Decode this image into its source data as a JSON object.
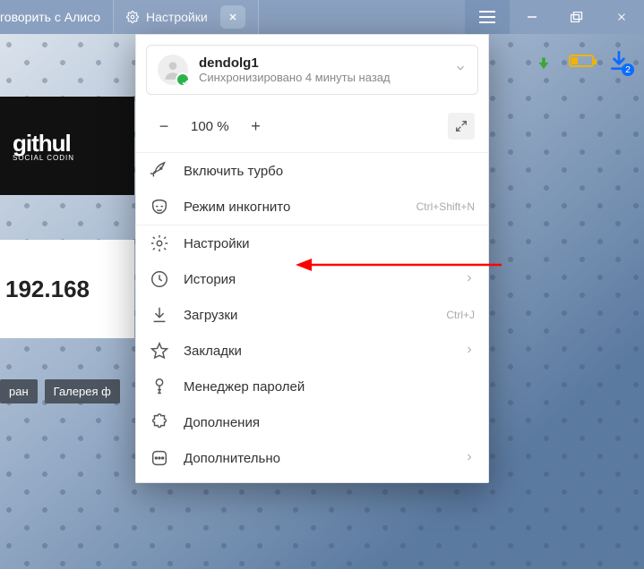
{
  "titlebar": {
    "tabs": [
      {
        "label": "говорить с Алисо"
      },
      {
        "label": "Настройки"
      }
    ]
  },
  "tray": {
    "download_count": "2"
  },
  "page": {
    "github_big": "githul",
    "github_small": "SOCIAL CODIN",
    "ip": "192.168",
    "chip1": "ран",
    "chip2": "Галерея ф"
  },
  "menu": {
    "profile": {
      "name": "dendolg1",
      "sync": "Синхронизировано 4 минуты назад"
    },
    "zoom": {
      "minus": "−",
      "value": "100 %",
      "plus": "+"
    },
    "items": [
      {
        "label": "Включить турбо",
        "shortcut": ""
      },
      {
        "label": "Режим инкогнито",
        "shortcut": "Ctrl+Shift+N"
      },
      {
        "label": "Настройки",
        "shortcut": ""
      },
      {
        "label": "История",
        "shortcut": "",
        "chevron": true
      },
      {
        "label": "Загрузки",
        "shortcut": "Ctrl+J"
      },
      {
        "label": "Закладки",
        "shortcut": "",
        "chevron": true
      },
      {
        "label": "Менеджер паролей",
        "shortcut": ""
      },
      {
        "label": "Дополнения",
        "shortcut": ""
      },
      {
        "label": "Дополнительно",
        "shortcut": "",
        "chevron": true
      }
    ]
  }
}
